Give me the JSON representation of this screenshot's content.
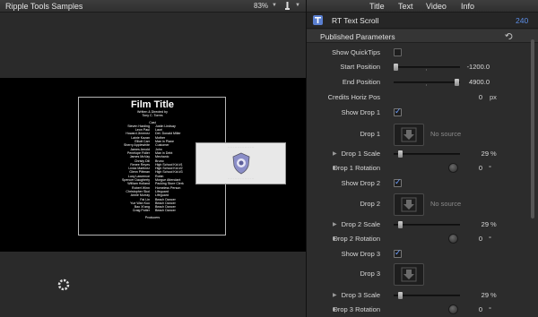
{
  "viewer": {
    "title": "Ripple Tools Samples",
    "zoom": "83%",
    "credits": {
      "title": "Film Title",
      "written_by": "Written & Directed by",
      "director": "Tony C. Torres",
      "cast_header": "Cast",
      "cast": [
        [
          "Steven Harding",
          "Justin Lindsay"
        ],
        [
          "Leon Paul",
          "Lauri"
        ],
        [
          "Howard Jimenez",
          "Det. Donald Miller"
        ],
        [
          "Lainie Kazan",
          "Mother"
        ],
        [
          "Elliott Carr",
          "Man in Plane"
        ],
        [
          "Sherry Applewhite",
          "Customer"
        ],
        [
          "James Arnold",
          "John"
        ],
        [
          "Penelope Fidler",
          "Man in Debt"
        ],
        [
          "James McVay",
          "Mechanic"
        ],
        [
          "Christy Dill",
          "Bruno"
        ],
        [
          "Renee Reyes",
          "High School Kid #1"
        ],
        [
          "Linda Martinez",
          "High School Kid #2"
        ],
        [
          "Glenn Pittman",
          "High School Kid #3"
        ],
        [
          "Lucy Lawrence",
          "Robin"
        ],
        [
          "Spencer Daugherty",
          "Morgue Attendant"
        ],
        [
          "William Holland",
          "Packing Store Clerk"
        ],
        [
          "Robert Winn",
          "Homeless Person"
        ],
        [
          "Christopher Skol",
          "Lifeguard"
        ],
        [
          "Annie Murray",
          "Lifeguard"
        ],
        [
          "Fai Lin",
          "Beach Dancer"
        ],
        [
          "Yue Wan Kuo",
          "Beach Dancer"
        ],
        [
          "Bao Xi'ang",
          "Beach Dancer"
        ],
        [
          "Craig Potter",
          "Beach Dancer"
        ]
      ],
      "producers": "Producers"
    }
  },
  "inspector": {
    "tabs": [
      "Title",
      "Text",
      "Video",
      "Info"
    ],
    "clip_name": "RT Text Scroll",
    "duration": "240",
    "section": "Published Parameters",
    "params": {
      "show_quicktips": "Show QuickTips",
      "start_position": "Start Position",
      "start_value": "-1200.0",
      "end_position": "End Position",
      "end_value": "4900.0",
      "credits_horiz_pos": "Credits Horiz Pos",
      "credits_value": "0",
      "credits_unit": "px",
      "show_drop1": "Show Drop 1",
      "drop1": "Drop 1",
      "no_source": "No source",
      "drop1_scale": "Drop 1 Scale",
      "drop1_scale_value": "29",
      "drop1_rotation": "Drop 1 Rotation",
      "drop1_rotation_value": "0",
      "show_drop2": "Show Drop 2",
      "drop2": "Drop 2",
      "drop2_scale": "Drop 2 Scale",
      "drop2_scale_value": "29",
      "drop2_rotation": "Drop 2 Rotation",
      "drop2_rotation_value": "0",
      "show_drop3": "Show Drop 3",
      "drop3": "Drop 3",
      "drop3_scale": "Drop 3 Scale",
      "drop3_scale_value": "29",
      "drop3_rotation": "Drop 3 Rotation",
      "drop3_rotation_value": "0",
      "percent": "%",
      "degree": "°"
    },
    "checks": {
      "show_quicktips": false,
      "show_drop1": true,
      "show_drop2": true,
      "show_drop3": true
    }
  },
  "colors": {
    "accent": "#5d8fe8",
    "check": "#6fa0ff"
  }
}
